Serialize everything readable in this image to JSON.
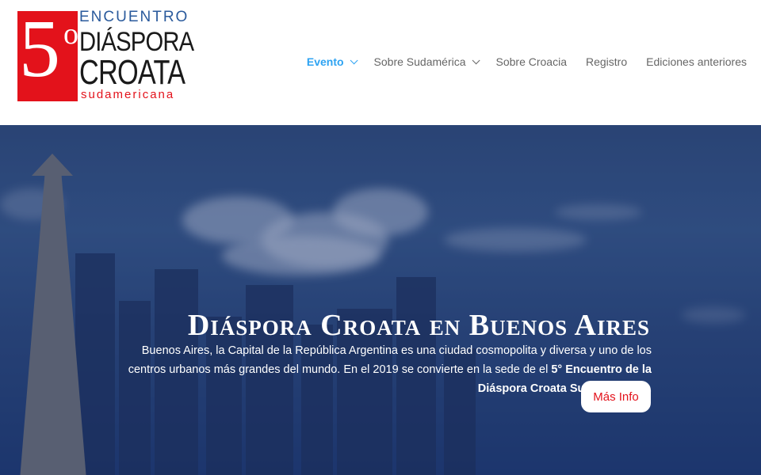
{
  "logo": {
    "number": "5",
    "degree": "o",
    "encuentro": "ENCUENTRO",
    "line1": "DIÁSPORA",
    "line2": "CROATA",
    "subtitle": "sudamericana"
  },
  "nav": {
    "items": [
      {
        "label": "Evento",
        "has_dropdown": true,
        "active": true
      },
      {
        "label": "Sobre Sudamérica",
        "has_dropdown": true,
        "active": false
      },
      {
        "label": "Sobre Croacia",
        "has_dropdown": false,
        "active": false
      },
      {
        "label": "Registro",
        "has_dropdown": false,
        "active": false
      },
      {
        "label": "Ediciones anteriores",
        "has_dropdown": false,
        "active": false
      }
    ]
  },
  "hero": {
    "title": "Diáspora Croata en Buenos Aires",
    "text_plain": "Buenos Aires, la Capital de la República Argentina es una ciudad cosmopolita y diversa y uno de los centros urbanos más grandes del mundo. En el 2019 se convierte en la sede de el ",
    "text_bold": "5° Encuentro de la Diáspora Croata Sudamericana.",
    "button_label": "Más Info"
  },
  "colors": {
    "accent": "#2ea3f2",
    "brand_red": "#e3121b",
    "brand_blue": "#2a5a9c",
    "nav_text": "#666666"
  }
}
